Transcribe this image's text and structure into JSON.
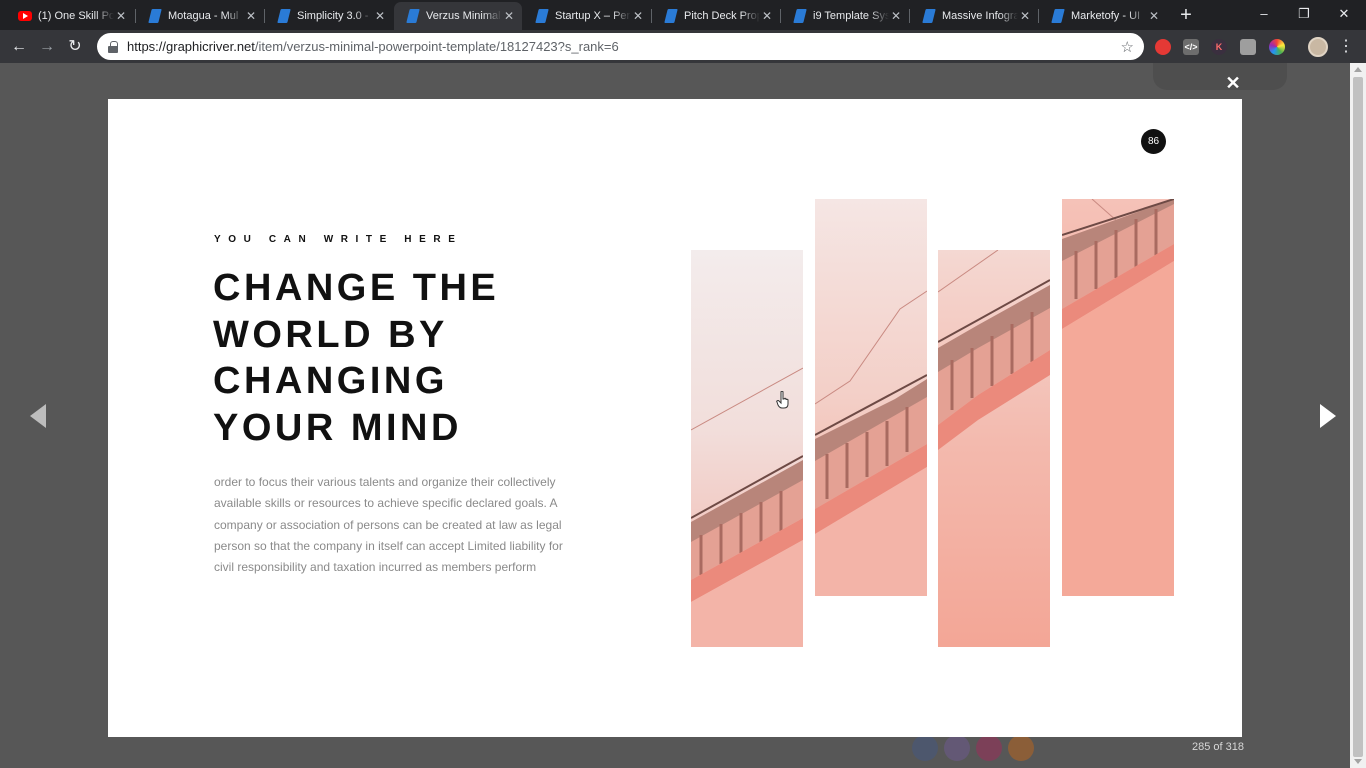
{
  "browser": {
    "tabs": [
      {
        "title": "(1) One Skill Po",
        "icon": "youtube-icon",
        "active": false
      },
      {
        "title": "Motagua - Mul",
        "icon": "envato-icon",
        "active": false
      },
      {
        "title": "Simplicity 3.0 -",
        "icon": "envato-icon",
        "active": false
      },
      {
        "title": "Verzus Minimal",
        "icon": "envato-icon",
        "active": true
      },
      {
        "title": "Startup X – Per",
        "icon": "envato-icon",
        "active": false
      },
      {
        "title": "Pitch Deck Prop",
        "icon": "envato-icon",
        "active": false
      },
      {
        "title": "i9 Template Sys",
        "icon": "envato-icon",
        "active": false
      },
      {
        "title": "Massive Infogra",
        "icon": "envato-icon",
        "active": false
      },
      {
        "title": "Marketofy - UI",
        "icon": "envato-icon",
        "active": false
      }
    ],
    "tab_close_glyph": "✕",
    "new_tab_glyph": "+",
    "window": {
      "minimize": "–",
      "restore": "❐",
      "close": "✕"
    },
    "nav": {
      "back": "←",
      "forward": "→",
      "reload": "↻"
    },
    "url_host": "https://graphicriver.net",
    "url_path": "/item/verzus-minimal-powerpoint-template/18127423?s_rank=6",
    "bookmark_glyph": "☆",
    "menu_glyph": "⋮"
  },
  "lightbox": {
    "close_glyph": "✕",
    "counter": "285 of 318",
    "prev_label": "previous",
    "next_label": "next"
  },
  "slide": {
    "number": "86",
    "eyebrow": "YOU CAN WRITE HERE",
    "headline_lines": [
      "CHANGE THE",
      "WORLD BY",
      "CHANGING",
      "YOUR MIND"
    ],
    "body": "order to focus their various talents and organize their collectively available skills or resources to achieve specific declared goals. A company or association of persons can be created at law as legal person so that the company in itself can accept Limited liability for civil responsibility and taxation incurred as members perform"
  },
  "colors": {
    "accent_pink": "#f4a293",
    "chrome_dark": "#202124",
    "chrome_toolbar": "#35363a",
    "overlay": "#575757"
  }
}
